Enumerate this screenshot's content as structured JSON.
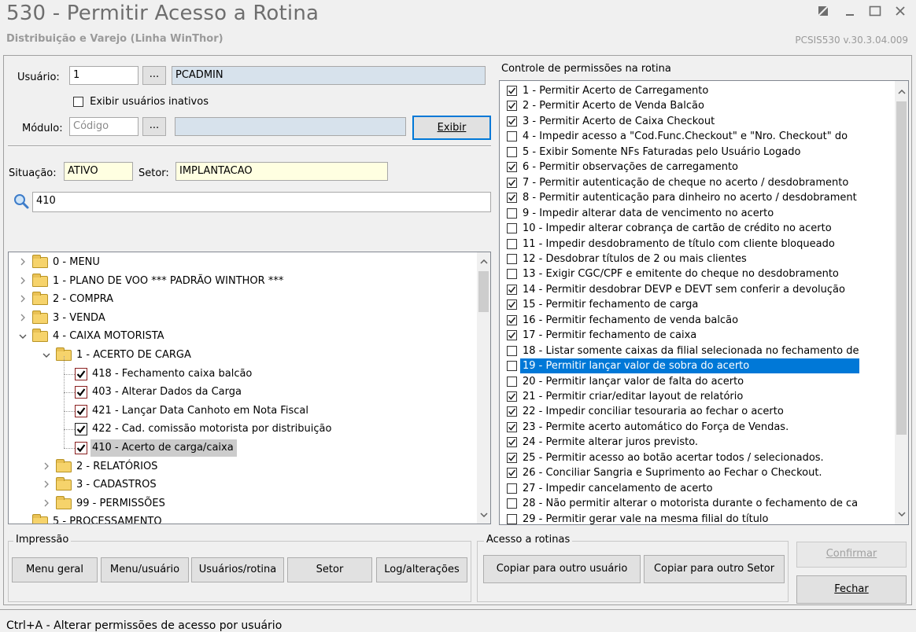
{
  "window": {
    "title": "530 - Permitir Acesso a Rotina",
    "subtitle": "Distribuição e Varejo (Linha WinThor)",
    "version": "PCSIS530  v.30.3.04.009"
  },
  "user_panel": {
    "usuario_label": "Usuário:",
    "usuario_code": "1",
    "usuario_name": "PCADMIN",
    "lookup_label": "...",
    "inactive_label": "Exibir usuários inativos",
    "modulo_label": "Módulo:",
    "modulo_placeholder": "Código",
    "modulo_name": "",
    "exibir_label": "Exibir",
    "situacao_label": "Situação:",
    "situacao_value": "ATIVO",
    "setor_label": "Setor:",
    "setor_value": "IMPLANTACAO",
    "search_value": "410"
  },
  "tree": {
    "items": [
      {
        "label": "0 - MENU"
      },
      {
        "label": "1 - PLANO DE VOO   ***  PADRÃO WINTHOR  ***"
      },
      {
        "label": "2 - COMPRA"
      },
      {
        "label": "3 - VENDA"
      },
      {
        "label": "4 - CAIXA MOTORISTA"
      },
      {
        "label": "1 - ACERTO DE CARGA"
      },
      {
        "label": "418 - Fechamento caixa balcão"
      },
      {
        "label": "403 - Alterar Dados da Carga"
      },
      {
        "label": "421 - Lançar Data Canhoto em Nota Fiscal"
      },
      {
        "label": "422 - Cad. comissão motorista por distribuição"
      },
      {
        "label": "410 - Acerto de carga/caixa"
      },
      {
        "label": "2 - RELATÓRIOS"
      },
      {
        "label": "3 - CADASTROS"
      },
      {
        "label": "99 - PERMISSÕES"
      },
      {
        "label": "5 - PROCESSAMENTO"
      }
    ]
  },
  "permissions": {
    "title": "Controle de permissões na rotina",
    "selected_index": 18,
    "items": [
      {
        "label": "1 - Permitir Acerto de Carregamento",
        "checked": true
      },
      {
        "label": "2 - Permitir Acerto de Venda Balcão",
        "checked": true
      },
      {
        "label": "3 - Permitir Acerto de Caixa Checkout",
        "checked": true
      },
      {
        "label": "4 - Impedir acesso a \"Cod.Func.Checkout\" e \"Nro. Checkout\" do",
        "checked": false
      },
      {
        "label": "5 - Exibir Somente NFs Faturadas pelo Usuário Logado",
        "checked": false
      },
      {
        "label": "6 - Permitir observações de carregamento",
        "checked": true
      },
      {
        "label": "7 - Permitir autenticação de cheque no acerto / desdobramento",
        "checked": true
      },
      {
        "label": "8 - Permitir autenticação para dinheiro no acerto / desdobrament",
        "checked": true
      },
      {
        "label": "9 - Impedir alterar data de vencimento no acerto",
        "checked": false
      },
      {
        "label": "10 - Impedir alterar cobrança de cartão de crédito no acerto",
        "checked": false
      },
      {
        "label": "11 - Impedir desdobramento de título com cliente bloqueado",
        "checked": false
      },
      {
        "label": "12 - Desdobrar títulos de 2 ou mais clientes",
        "checked": false
      },
      {
        "label": "13 - Exigir CGC/CPF e emitente do cheque no desdobramento",
        "checked": false
      },
      {
        "label": "14 - Permitir desdobrar DEVP e DEVT sem conferir a devolução",
        "checked": true
      },
      {
        "label": "15 - Permitir fechamento de carga",
        "checked": true
      },
      {
        "label": "16 - Permitir fechamento de venda balcão",
        "checked": true
      },
      {
        "label": "17 - Permitir fechamento de caixa",
        "checked": true
      },
      {
        "label": "18 - Listar somente caixas da filial selecionada no fechamento de",
        "checked": false
      },
      {
        "label": "19 - Permitir lançar valor de sobra do acerto",
        "checked": false
      },
      {
        "label": "20 - Permitir lançar valor de falta do acerto",
        "checked": false
      },
      {
        "label": "21 - Permitir criar/editar layout de relatório",
        "checked": true
      },
      {
        "label": "22 - Impedir conciliar tesouraria ao fechar o acerto",
        "checked": true
      },
      {
        "label": "23 - Permite acerto automático do Força de Vendas.",
        "checked": true
      },
      {
        "label": "24 - Permite alterar juros previsto.",
        "checked": true
      },
      {
        "label": "25 - Permitir acesso ao botão acertar todos / selecionados.",
        "checked": true
      },
      {
        "label": "26 - Conciliar Sangria e Suprimento ao Fechar o Checkout.",
        "checked": true
      },
      {
        "label": "27 - Impedir cancelamento de acerto",
        "checked": false
      },
      {
        "label": "28 - Não permitir alterar o motorista durante o fechamento de ca",
        "checked": false
      },
      {
        "label": "29 - Permitir gerar vale na mesma filial do título",
        "checked": false
      }
    ]
  },
  "impressao": {
    "title": "Impressão",
    "menu_geral": "Menu geral",
    "menu_usuario": "Menu/usuário",
    "usuarios_rotina": "Usuários/rotina",
    "setor": "Setor",
    "log_alteracoes": "Log/alterações"
  },
  "acesso": {
    "title": "Acesso a rotinas",
    "copiar_usuario": "Copiar para outro usuário",
    "copiar_setor": "Copiar para outro Setor"
  },
  "actions": {
    "confirmar": "Confirmar",
    "fechar": "Fechar"
  },
  "status_bar": {
    "text": "Ctrl+A - Alterar permissões de acesso por usuário"
  }
}
